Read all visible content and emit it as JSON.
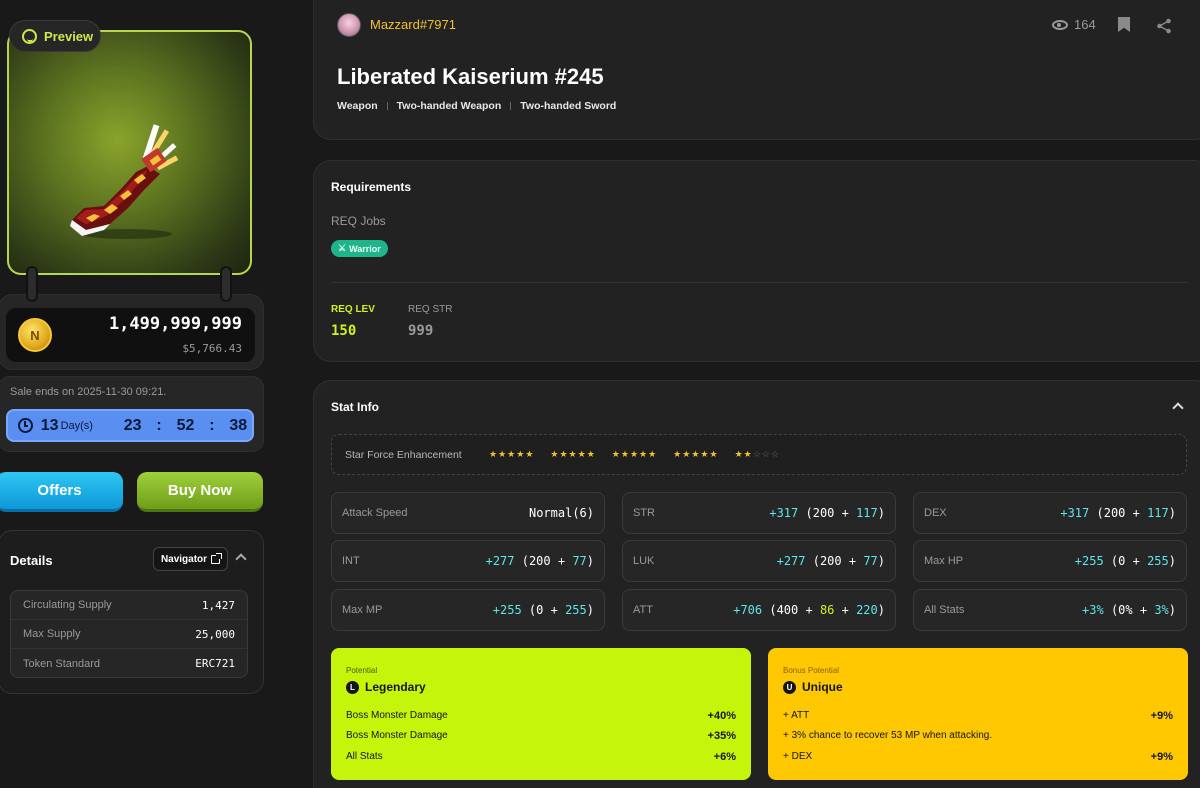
{
  "preview": {
    "label": "Preview"
  },
  "price": {
    "amount": "1,499,999,999",
    "usd": "$5,766.43",
    "coin_glyph": "N"
  },
  "sale": {
    "ends_text": "Sale ends on 2025-11-30 09:21.",
    "days": "13",
    "days_unit": "Day(s)",
    "hours": "23",
    "minutes": "52",
    "seconds": "38",
    "sep": ":"
  },
  "actions": {
    "offers": "Offers",
    "buy": "Buy Now"
  },
  "details": {
    "title": "Details",
    "navigator": "Navigator",
    "rows": [
      {
        "label": "Circulating Supply",
        "value": "1,427"
      },
      {
        "label": "Max Supply",
        "value": "25,000"
      },
      {
        "label": "Token Standard",
        "value": "ERC721"
      }
    ]
  },
  "header": {
    "username": "Mazzard#7971",
    "views": "164",
    "title": "Liberated Kaiserium #245",
    "categories": [
      "Weapon",
      "Two-handed Weapon",
      "Two-handed Sword"
    ]
  },
  "requirements": {
    "title": "Requirements",
    "jobs_label": "REQ Jobs",
    "job": "Warrior",
    "req_lev_label": "REQ LEV",
    "req_lev": "150",
    "req_str_label": "REQ STR",
    "req_str": "999"
  },
  "stat_info": {
    "title": "Stat Info",
    "star_force_label": "Star Force Enhancement",
    "star_force": {
      "filled": 22,
      "total": 25
    },
    "stats": [
      {
        "label": "Attack Speed",
        "value": "Normal(6)"
      },
      {
        "label": "STR",
        "total": "+317",
        "base": "200",
        "bonus": [
          "117"
        ]
      },
      {
        "label": "DEX",
        "total": "+317",
        "base": "200",
        "bonus": [
          "117"
        ]
      },
      {
        "label": "INT",
        "total": "+277",
        "base": "200",
        "bonus": [
          "77"
        ]
      },
      {
        "label": "LUK",
        "total": "+277",
        "base": "200",
        "bonus": [
          "77"
        ]
      },
      {
        "label": "Max HP",
        "total": "+255",
        "base": "0",
        "bonus": [
          "255"
        ]
      },
      {
        "label": "Max MP",
        "total": "+255",
        "base": "0",
        "bonus": [
          "255"
        ]
      },
      {
        "label": "ATT",
        "total": "+706",
        "base": "400",
        "bonus": [
          "86",
          "220"
        ]
      },
      {
        "label": "All Stats",
        "total": "+3%",
        "base": "0%",
        "bonus": [
          "3%"
        ]
      }
    ]
  },
  "potential": {
    "tag": "Potential",
    "grade": "Legendary",
    "grade_letter": "L",
    "lines": [
      {
        "text": "Boss Monster Damage",
        "value": "+40%"
      },
      {
        "text": "Boss Monster Damage",
        "value": "+35%"
      },
      {
        "text": "All Stats",
        "value": "+6%"
      }
    ]
  },
  "bonus_potential": {
    "tag": "Bonus Potential",
    "grade": "Unique",
    "grade_letter": "U",
    "lines": [
      {
        "text": "+ ATT",
        "value": "+9%"
      },
      {
        "text": "+ 3% chance to recover 53 MP when attacking.",
        "value": ""
      },
      {
        "text": "+ DEX",
        "value": "+9%"
      }
    ]
  },
  "colors": {
    "accent_lime": "#cdf21f",
    "accent_cyan": "#5ee6ea",
    "gold": "#f1c232",
    "warrior": "#1fb58a"
  }
}
